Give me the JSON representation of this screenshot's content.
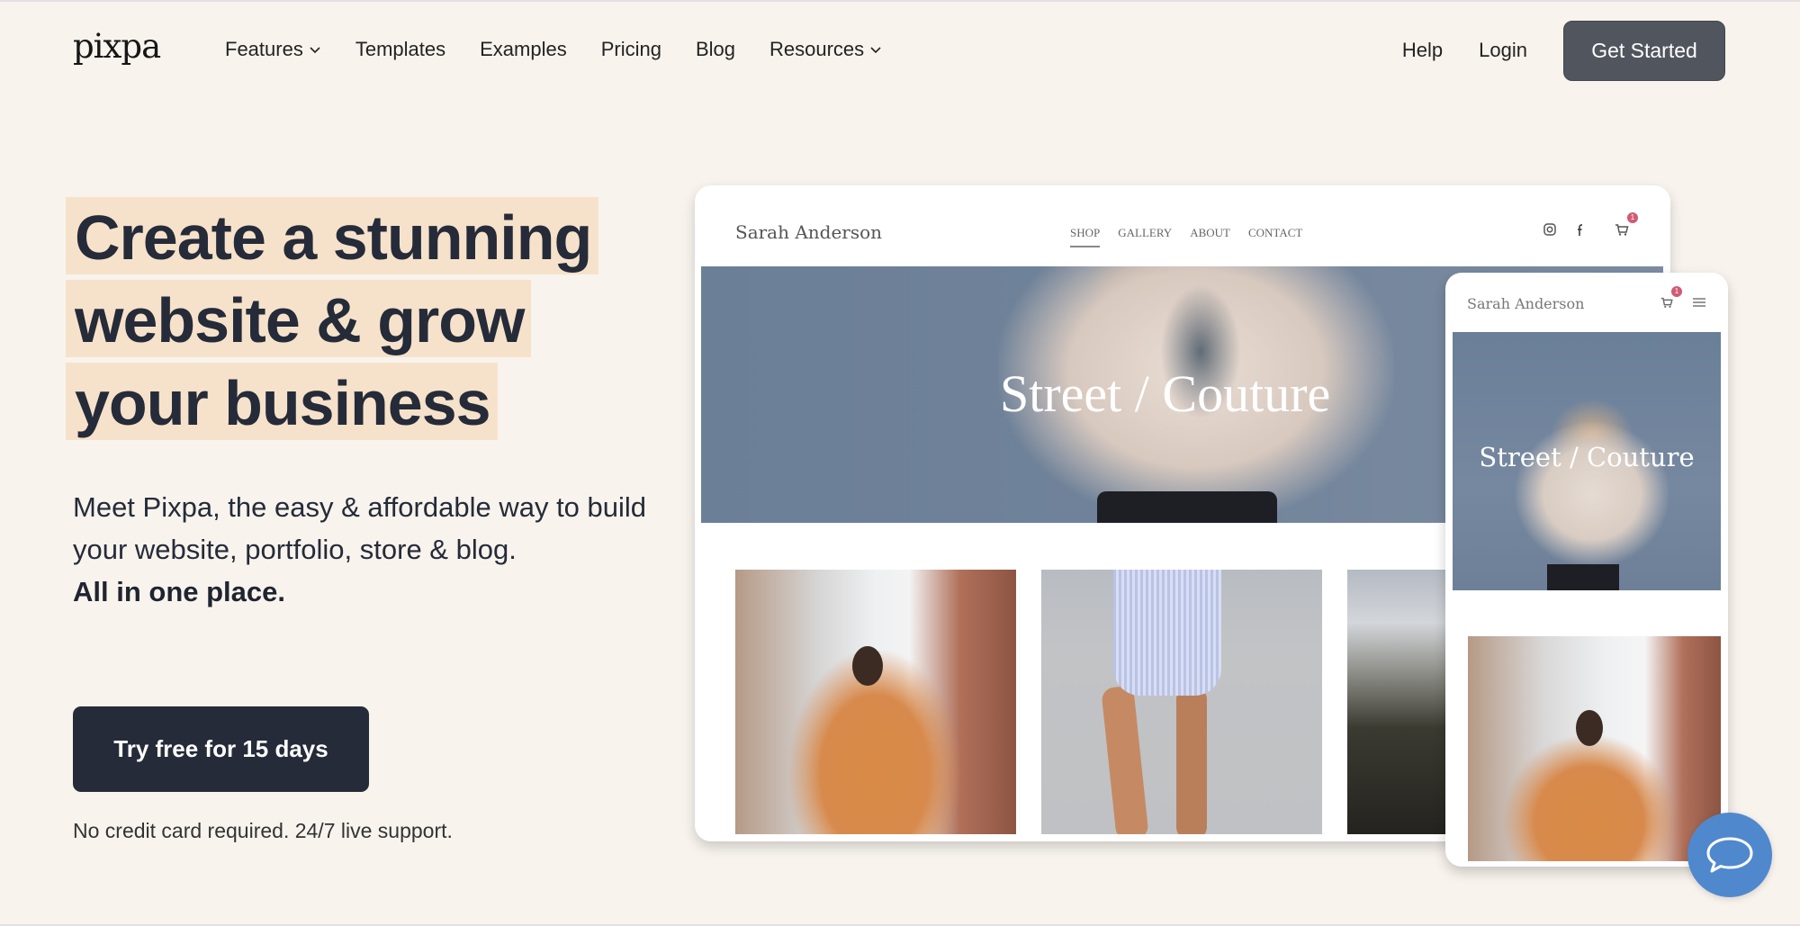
{
  "nav": {
    "logo": "pixpa",
    "links": [
      {
        "label": "Features",
        "has_dropdown": true
      },
      {
        "label": "Templates",
        "has_dropdown": false
      },
      {
        "label": "Examples",
        "has_dropdown": false
      },
      {
        "label": "Pricing",
        "has_dropdown": false
      },
      {
        "label": "Blog",
        "has_dropdown": false
      },
      {
        "label": "Resources",
        "has_dropdown": true
      }
    ],
    "help": "Help",
    "login": "Login",
    "cta": "Get Started"
  },
  "hero": {
    "headline_lines": [
      "Create a stunning",
      "website & grow",
      "your business"
    ],
    "subcopy": "Meet Pixpa, the easy & affordable way to build your website, portfolio, store & blog.",
    "subcopy_strong": "All in one place.",
    "cta": "Try free for 15 days",
    "fineprint": "No credit card required. 24/7 live support."
  },
  "desktop_mockup": {
    "site_title": "Sarah Anderson",
    "menu": [
      "SHOP",
      "GALLERY",
      "ABOUT",
      "CONTACT"
    ],
    "active_menu": "SHOP",
    "icons": [
      "instagram-icon",
      "facebook-icon",
      "cart-icon"
    ],
    "cart_count": "1",
    "hero_text": "Street / Couture"
  },
  "mobile_mockup": {
    "site_title": "Sarah Anderson",
    "cart_count": "1",
    "hero_text": "Street / Couture"
  },
  "chat": {
    "icon": "chat-bubble-icon"
  },
  "colors": {
    "background": "#f8f3ed",
    "highlight": "#f6e2cb",
    "primary_dark": "#252b38",
    "get_started_bg": "#51555e",
    "chat_blue": "#4f88cd",
    "badge": "#d15a75"
  }
}
